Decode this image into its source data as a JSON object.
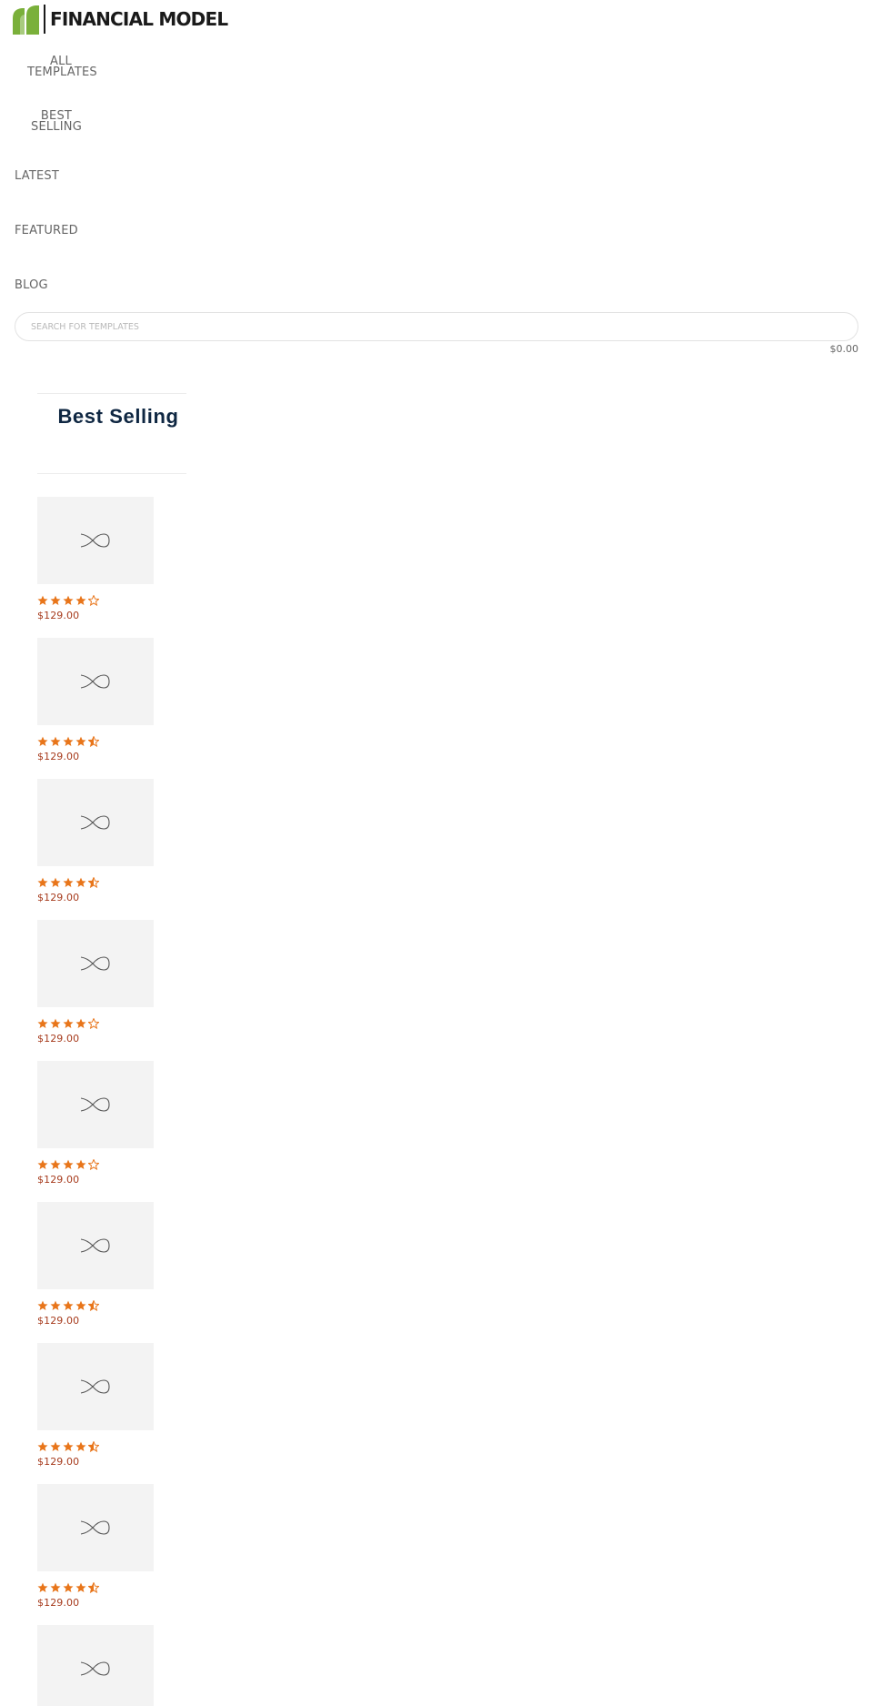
{
  "brand": {
    "name": "FINANCIAL MODEL",
    "accent": "#7ab03a"
  },
  "nav": [
    {
      "label": "ALL TEMPLATES",
      "line1": "ALL",
      "line2": "TEMPLATES"
    },
    {
      "label": "BEST SELLING",
      "line1": "BEST",
      "line2": "SELLING"
    },
    {
      "label": "LATEST"
    },
    {
      "label": "FEATURED"
    },
    {
      "label": "BLOG"
    }
  ],
  "search": {
    "placeholder": "SEARCH FOR TEMPLATES",
    "icon": "search-icon"
  },
  "cart": {
    "total": "$0.00"
  },
  "section": {
    "title": "Best Selling"
  },
  "products": [
    {
      "rating": 4,
      "price": "$129.00"
    },
    {
      "rating": 4.5,
      "price": "$129.00"
    },
    {
      "rating": 4.5,
      "price": "$129.00"
    },
    {
      "rating": 4,
      "price": "$129.00"
    },
    {
      "rating": 4,
      "price": "$129.00"
    },
    {
      "rating": 4.5,
      "price": "$129.00"
    },
    {
      "rating": 4.5,
      "price": "$129.00"
    },
    {
      "rating": 4.5,
      "price": "$129.00"
    },
    {
      "rating": null,
      "price": null
    }
  ],
  "colors": {
    "star": "#e8751a",
    "price": "#a63a1c",
    "title": "#0f2742",
    "thumb_bg": "#f3f3f3"
  },
  "icons": {
    "placeholder": "infinity-icon",
    "star_full": "star-icon",
    "star_half": "star-half-icon",
    "star_empty": "star-empty-icon"
  }
}
